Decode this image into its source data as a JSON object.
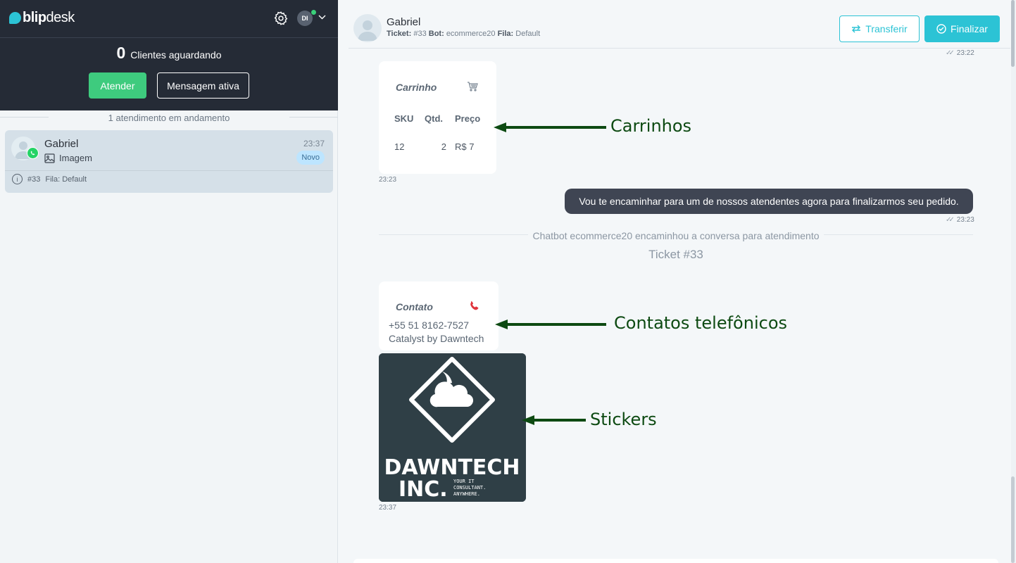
{
  "app": {
    "logo_part1": "blip",
    "logo_part2": "desk",
    "user_initials": "DI",
    "accent_color": "#2cc3d5",
    "online_color": "#3ad07a"
  },
  "queue": {
    "count": "0",
    "label": "Clientes aguardando",
    "attend_button": "Atender",
    "active_message_button": "Mensagem ativa",
    "in_progress_label": "1 atendimento em andamento"
  },
  "conversation_list": [
    {
      "name": "Gabriel",
      "time": "23:37",
      "preview": "Imagem",
      "badge": "Novo",
      "ticket": "#33",
      "queue_label": "Fila:",
      "queue_value": "Default",
      "channel_icon": "whatsapp-icon"
    }
  ],
  "chat_header": {
    "name": "Gabriel",
    "ticket_label": "Ticket:",
    "ticket_value": "#33",
    "bot_label": "Bot:",
    "bot_value": "ecommerce20",
    "queue_label": "Fila:",
    "queue_value": "Default",
    "transfer_button": "Transferir",
    "finish_button": "Finalizar"
  },
  "messages": {
    "top_stamp": "23:22",
    "cart": {
      "title": "Carrinho",
      "headers": [
        "SKU",
        "Qtd.",
        "Preço"
      ],
      "rows": [
        [
          "12",
          "2",
          "R$ 7"
        ]
      ],
      "time": "23:23"
    },
    "bot_message": {
      "text": "Vou te encaminhar para um de nossos atendentes agora para finalizarmos seu pedido.",
      "time": "23:23"
    },
    "system": {
      "text": "Chatbot ecommerce20 encaminhou a conversa para atendimento",
      "ticket": "Ticket #33"
    },
    "contact": {
      "title": "Contato",
      "phone": "+55 51 8162-7527",
      "name": "Catalyst by Dawntech"
    },
    "sticker": {
      "line1": "DAWNTECH",
      "line2": "INC.",
      "tag1": "YOUR IT",
      "tag2": "CONSULTANT.",
      "tag3": "ANYWHERE.",
      "time": "23:37"
    }
  },
  "annotations": {
    "cart": "Carrinhos",
    "contact": "Contatos telefônicos",
    "sticker": "Stickers",
    "color": "#0d4a12"
  }
}
